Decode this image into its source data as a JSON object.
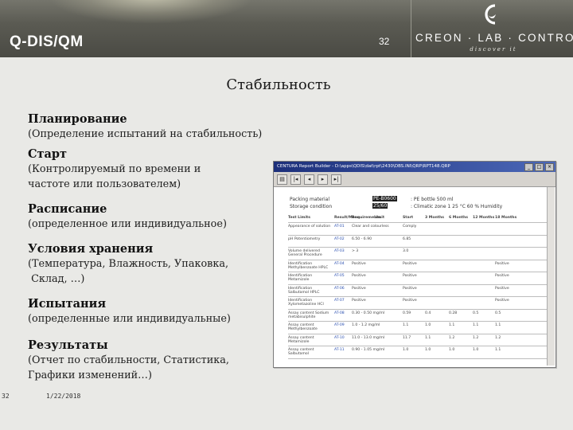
{
  "header": {
    "app_title": "Q-DIS/QM",
    "page_number": "32",
    "brand_name": "CREON · LAB · CONTROL",
    "brand_tagline": "discover it"
  },
  "slide": {
    "title": "Стабильность",
    "sections": [
      {
        "heading": "Планирование",
        "lines": [
          "(Определение испытаний на стабильность)"
        ]
      },
      {
        "heading": "Старт",
        "lines": [
          "(Контролируемый по времени и",
          "частоте или пользователем)"
        ]
      },
      {
        "heading": "Расписание",
        "lines": [
          "(определенное или индивидуальное)"
        ]
      },
      {
        "heading": "Условия хранения",
        "lines": [
          "(Температура, Влажность, Упаковка,",
          " Склад, …)"
        ]
      },
      {
        "heading": "Испытания",
        "lines": [
          "(определенные или индивидуальные)"
        ]
      },
      {
        "heading": "Результаты",
        "lines": [
          "(Отчет по стабильности, Статистика,",
          "Графики изменений…)"
        ]
      }
    ]
  },
  "footer": {
    "slide_number": "32",
    "date": "1/22/2018"
  },
  "report": {
    "window_title": "CENTURA Report Builder - D:\\apps\\QDIS\\dat\\rpt\\2430\\DBS.INI\\QRP\\RPT148.QRP",
    "packing_label": "Packing material",
    "packing_value": "PE-B0600",
    "packing_desc": ": PE bottle 500 ml",
    "storage_label": "Storage condition",
    "storage_value": "25/60",
    "storage_desc": ": Climatic zone 1 25 °C 60 % Humidity",
    "columns": [
      "Test Limits",
      "Result/Mean",
      "Requirements",
      "Limit",
      "Start",
      "3 Months",
      "6 Months",
      "12 Months",
      "18 Months"
    ],
    "rows": [
      {
        "test": "Appearance of solution",
        "ref": "AT-01",
        "req": "Clear and colourless",
        "start": "Comply",
        "m3": "",
        "m6": "",
        "m12": "",
        "m18": ""
      },
      {
        "test": "pH Potentiometry",
        "ref": "AT-02",
        "req": "6.50 - 6.90",
        "start": "6.85",
        "m3": "",
        "m6": "",
        "m12": "",
        "m18": ""
      },
      {
        "test": "Volume delivered General Procedure",
        "ref": "AT-03",
        "req": "> 3",
        "start": "3.0",
        "m3": "",
        "m6": "",
        "m12": "",
        "m18": ""
      },
      {
        "test": "Identification Methylbenzoate HPLC",
        "ref": "AT-04",
        "req": "Positive",
        "start": "Positive",
        "m3": "",
        "m6": "",
        "m12": "",
        "m18": "Positive"
      },
      {
        "test": "Identification Metamizole",
        "ref": "AT-05",
        "req": "Positive",
        "start": "Positive",
        "m3": "",
        "m6": "",
        "m12": "",
        "m18": "Positive"
      },
      {
        "test": "Identification Salbutamol HPLC",
        "ref": "AT-06",
        "req": "Positive",
        "start": "Positive",
        "m3": "",
        "m6": "",
        "m12": "",
        "m18": "Positive"
      },
      {
        "test": "Identification Xylometazoline HCl",
        "ref": "AT-07",
        "req": "Positive",
        "start": "Positive",
        "m3": "",
        "m6": "",
        "m12": "",
        "m18": "Positive"
      },
      {
        "test": "Assay content Sodium metabisulphite",
        "ref": "AT-08",
        "req": "0.30 - 0.50 mg/ml",
        "start": "0.59",
        "m3": "0.4",
        "m6": "0.28",
        "m12": "0.5",
        "m18": "0.5"
      },
      {
        "test": "Assay content Methylbenzoate",
        "ref": "AT-09",
        "req": "1.0 - 1.2 mg/ml",
        "start": "1.1",
        "m3": "1.0",
        "m6": "1.1",
        "m12": "1.1",
        "m18": "1.1"
      },
      {
        "test": "Assay content Metamizole",
        "ref": "AT-10",
        "req": "11.0 - 13.0 mg/ml",
        "start": "11.7",
        "m3": "1.1",
        "m6": "1.2",
        "m12": "1.2",
        "m18": "1.2"
      },
      {
        "test": "Assay content Salbutamol",
        "ref": "AT-11",
        "req": "0.90 - 1.05 mg/ml",
        "start": "1.0",
        "m3": "1.0",
        "m6": "1.0",
        "m12": "1.0",
        "m18": "1.1"
      }
    ]
  }
}
